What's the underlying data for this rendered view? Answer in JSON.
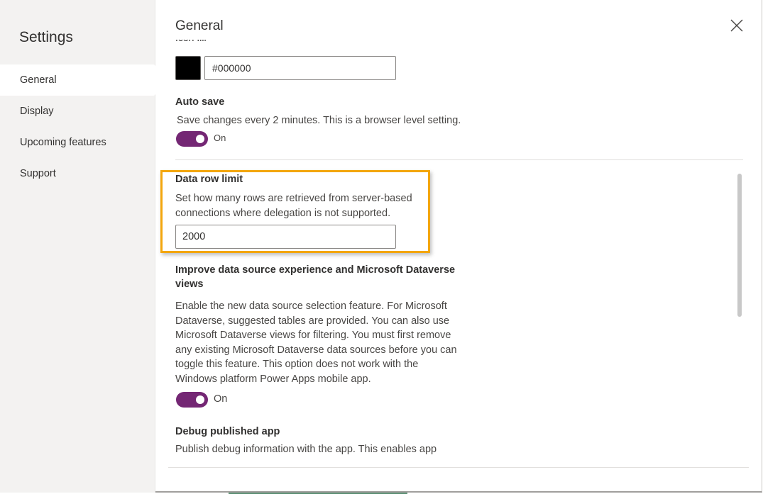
{
  "sidebar": {
    "title": "Settings",
    "items": [
      {
        "label": "General",
        "active": true
      },
      {
        "label": "Display",
        "active": false
      },
      {
        "label": "Upcoming features",
        "active": false
      },
      {
        "label": "Support",
        "active": false
      }
    ]
  },
  "content": {
    "title": "General",
    "close_icon": "close-icon",
    "icon_fill": {
      "label": "Icon fill",
      "swatch_color": "#000000",
      "value": "#000000"
    },
    "auto_save": {
      "label": "Auto save",
      "description": "Save changes every 2 minutes. This is a browser level setting.",
      "toggle_on": true,
      "state_label": "On"
    },
    "data_row_limit": {
      "label": "Data row limit",
      "description_line1": "Set how many rows are retrieved from server-based",
      "description_line2": "connections where delegation is not supported.",
      "value": "2000",
      "highlight_color": "#f3a60d"
    },
    "improve_data_source": {
      "label_line1": "Improve data source experience and Microsoft Dataverse",
      "label_line2": "views",
      "description_lines": [
        "Enable the new data source selection feature. For Microsoft",
        "Dataverse, suggested tables are provided. You can also use",
        "Microsoft Dataverse views for filtering. You must first remove",
        "any existing Microsoft Dataverse data sources before you can",
        "toggle this feature. This option does not work with the",
        "Windows platform Power Apps mobile app."
      ],
      "toggle_on": true,
      "state_label": "On"
    },
    "debug_published_app": {
      "label": "Debug published app",
      "description": "Publish debug information with the app. This enables app"
    }
  },
  "colors": {
    "toggle_accent": "#742774",
    "sidebar_bg": "#f3f2f1"
  }
}
